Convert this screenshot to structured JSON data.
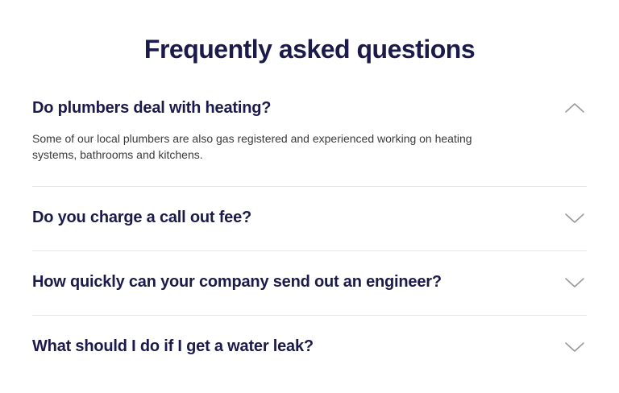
{
  "faq": {
    "title": "Frequently asked questions",
    "items": [
      {
        "question": "Do plumbers deal with heating?",
        "answer": "Some of our local plumbers are also gas registered and experienced working on heating systems, bathrooms and kitchens.",
        "expanded": true,
        "toggle_icon": "chevron-up-icon"
      },
      {
        "question": "Do you charge a call out fee?",
        "expanded": false,
        "toggle_icon": "chevron-down-icon"
      },
      {
        "question": "How quickly can your company send out an engineer?",
        "expanded": false,
        "toggle_icon": "chevron-down-icon"
      },
      {
        "question": "What should I do if I get a water leak?",
        "expanded": false,
        "toggle_icon": "chevron-down-icon"
      }
    ]
  },
  "colors": {
    "heading": "#1c1a4b",
    "body_text": "#3a3a3a",
    "divider": "#e4e4e4",
    "chevron": "#9a9a9a"
  }
}
